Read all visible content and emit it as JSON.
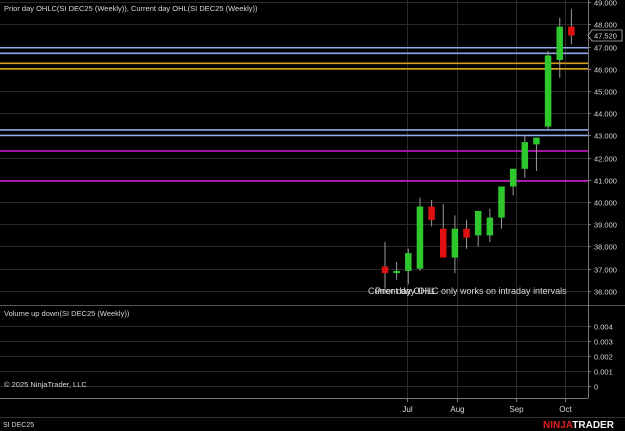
{
  "price_panel": {
    "indicator_label": "Prior day OHLC(SI DEC25 (Weekly)), Current day OHL(SI DEC25 (Weekly))",
    "notice_text": "Prior day OHLC only works on intraday intervals",
    "overlap_texts": [
      "Current day OHL"
    ],
    "current_price_label": "47.520"
  },
  "volume_panel": {
    "indicator_label": "Volume up down(SI DEC25 (Weekly))"
  },
  "copyright": "© 2025 NinjaTrader, LLC",
  "instrument_tab": "SI DEC25",
  "brand": {
    "part1": "NINJA",
    "part2": "TRADER"
  },
  "colors": {
    "up_candle": "#2ec72e",
    "down_candle": "#e01010",
    "line_blue": "#8ea8e8",
    "line_orange": "#d4a017",
    "line_magenta": "#d21ad2",
    "background": "#000000",
    "grid": "#2a2a2a"
  },
  "chart_data": {
    "type": "candlestick",
    "y_axis_ticks": [
      "49.000",
      "48.000",
      "47.000",
      "46.000",
      "45.000",
      "44.000",
      "43.000",
      "42.000",
      "41.000",
      "40.000",
      "39.000",
      "38.000",
      "37.000",
      "36.000"
    ],
    "ylim": [
      35.5,
      49.1
    ],
    "x_axis_labels": [
      "Jul",
      "Aug",
      "Sep",
      "Oct"
    ],
    "volume_axis_ticks": [
      "0.004",
      "0.003",
      "0.002",
      "0.001",
      "0"
    ],
    "volume_ylim": [
      -0.0002,
      0.0045
    ],
    "reference_lines": [
      {
        "value": 46.95,
        "color": "blue"
      },
      {
        "value": 46.7,
        "color": "blue"
      },
      {
        "value": 46.25,
        "color": "orange"
      },
      {
        "value": 46.0,
        "color": "orange"
      },
      {
        "value": 43.25,
        "color": "blue"
      },
      {
        "value": 43.0,
        "color": "blue"
      },
      {
        "value": 42.3,
        "color": "magenta"
      },
      {
        "value": 40.95,
        "color": "magenta"
      }
    ],
    "candles": [
      {
        "open": 37.1,
        "high": 38.2,
        "low": 36.1,
        "close": 36.8
      },
      {
        "open": 36.8,
        "high": 37.3,
        "low": 36.5,
        "close": 36.9
      },
      {
        "open": 36.9,
        "high": 37.9,
        "low": 36.3,
        "close": 37.7
      },
      {
        "open": 37.0,
        "high": 40.2,
        "low": 36.9,
        "close": 39.8
      },
      {
        "open": 39.8,
        "high": 40.1,
        "low": 38.9,
        "close": 39.2
      },
      {
        "open": 38.8,
        "high": 39.9,
        "low": 37.6,
        "close": 37.5
      },
      {
        "open": 37.5,
        "high": 39.4,
        "low": 36.8,
        "close": 38.8
      },
      {
        "open": 38.8,
        "high": 39.2,
        "low": 37.9,
        "close": 38.4
      },
      {
        "open": 38.5,
        "high": 39.6,
        "low": 38.0,
        "close": 39.6
      },
      {
        "open": 38.5,
        "high": 39.7,
        "low": 38.2,
        "close": 39.3
      },
      {
        "open": 39.3,
        "high": 40.5,
        "low": 38.8,
        "close": 40.7
      },
      {
        "open": 40.7,
        "high": 41.5,
        "low": 40.3,
        "close": 41.5
      },
      {
        "open": 41.5,
        "high": 43.0,
        "low": 41.1,
        "close": 42.7
      },
      {
        "open": 42.6,
        "high": 42.9,
        "low": 41.4,
        "close": 42.9
      },
      {
        "open": 43.4,
        "high": 46.8,
        "low": 43.3,
        "close": 46.6
      },
      {
        "open": 46.4,
        "high": 48.3,
        "low": 45.6,
        "close": 47.9
      },
      {
        "open": 47.9,
        "high": 48.7,
        "low": 47.1,
        "close": 47.5
      }
    ]
  }
}
